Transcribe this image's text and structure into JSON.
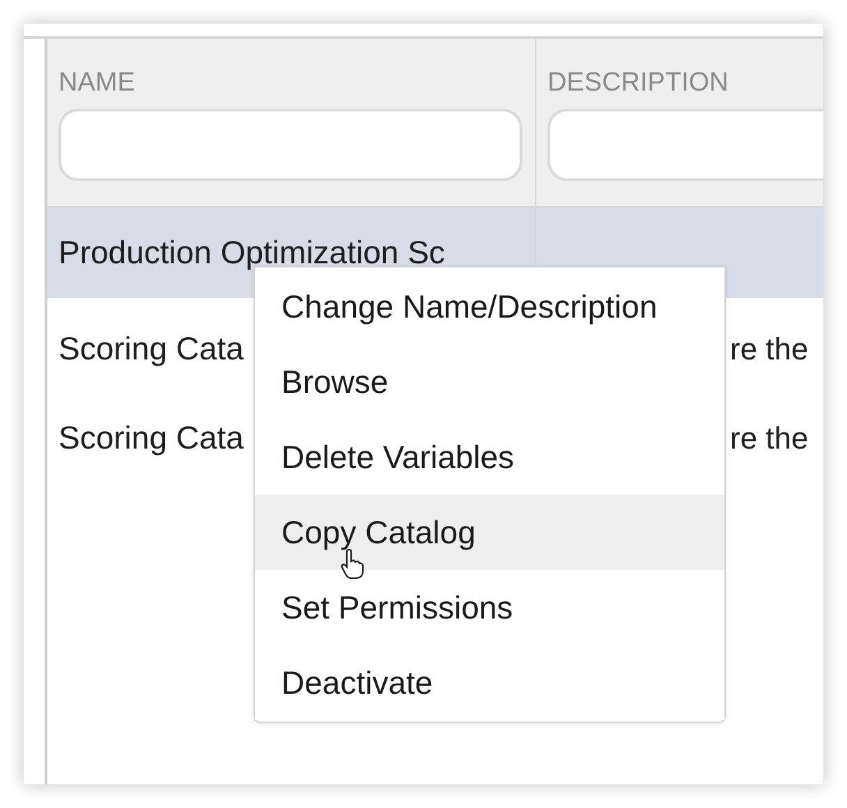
{
  "table": {
    "columns": [
      {
        "label": "NAME"
      },
      {
        "label": "DESCRIPTION"
      }
    ],
    "rows": [
      {
        "name": "Production Optimization Sc",
        "selected": true
      },
      {
        "name": "Scoring Cata",
        "description": "re the",
        "selected": false
      },
      {
        "name": "Scoring Cata",
        "description": "re the",
        "selected": false
      }
    ]
  },
  "context_menu": {
    "items": [
      {
        "label": "Change Name/Description",
        "hovered": false
      },
      {
        "label": "Browse",
        "hovered": false
      },
      {
        "label": "Delete Variables",
        "hovered": false
      },
      {
        "label": "Copy Catalog",
        "hovered": true
      },
      {
        "label": "Set Permissions",
        "hovered": false
      },
      {
        "label": "Deactivate",
        "hovered": false
      }
    ]
  }
}
